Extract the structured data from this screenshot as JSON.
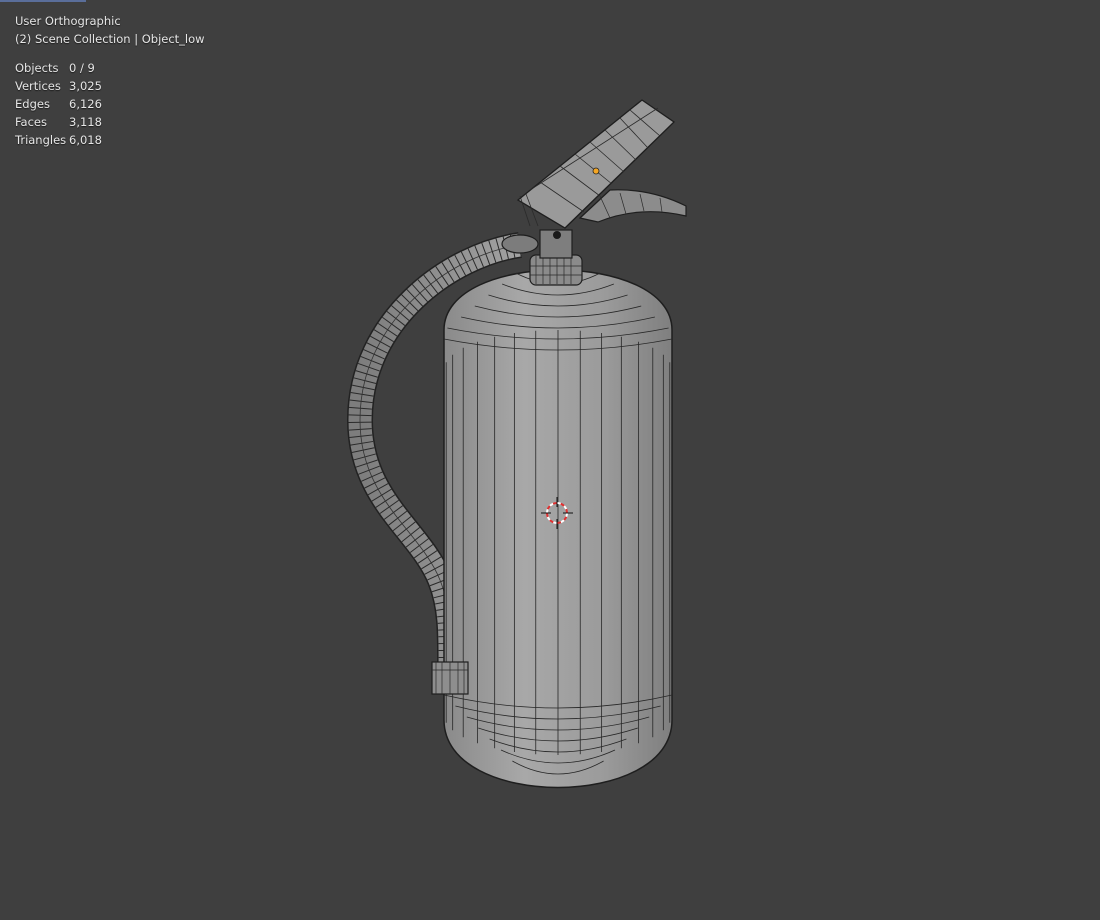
{
  "viewport": {
    "view_name": "User Orthographic",
    "collection_info": "(2) Scene Collection | Object_low",
    "stats": [
      {
        "label": "Objects",
        "value": "0 / 9"
      },
      {
        "label": "Vertices",
        "value": "3,025"
      },
      {
        "label": "Edges",
        "value": "6,126"
      },
      {
        "label": "Faces",
        "value": "3,118"
      },
      {
        "label": "Triangles",
        "value": "6,018"
      }
    ]
  },
  "colors": {
    "background": "#3f3f3f",
    "mesh_fill": "#9a9a9a",
    "wire": "#1e1e1e",
    "origin_dot": "#f5a623",
    "cursor_red": "#e03030"
  },
  "icons": [
    "3d-cursor-icon",
    "origin-point-icon"
  ]
}
